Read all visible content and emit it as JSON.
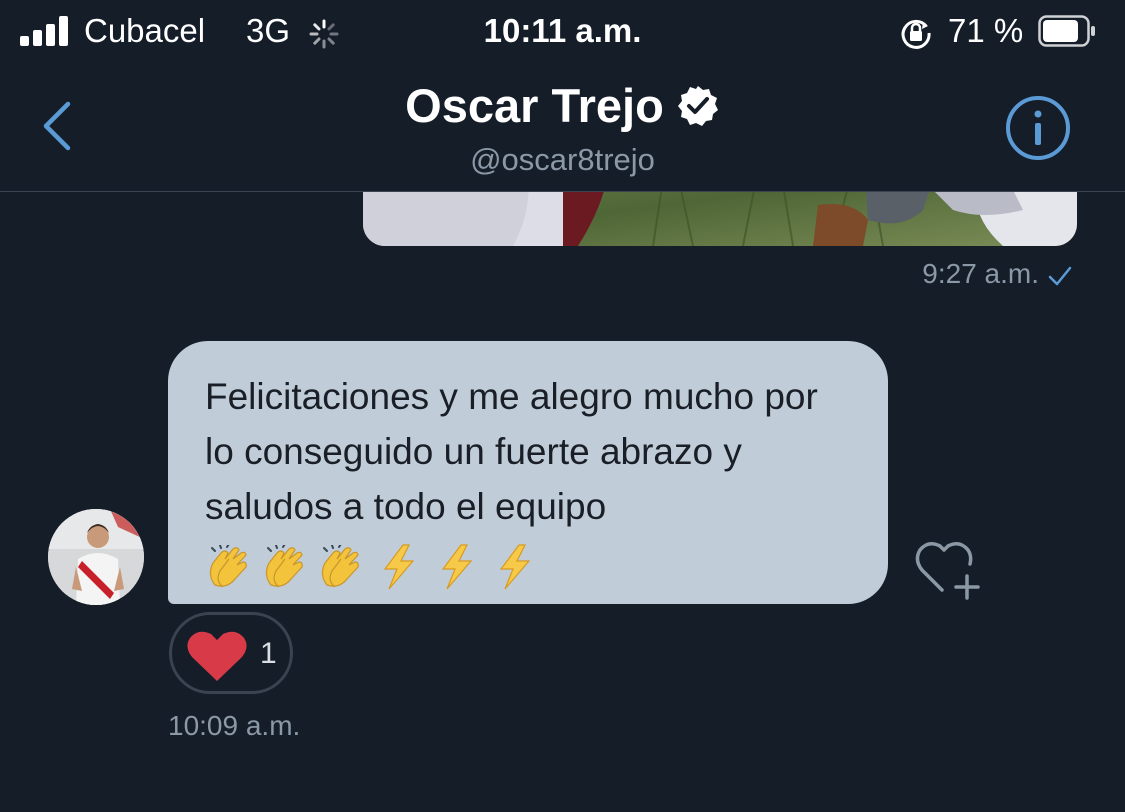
{
  "status_bar": {
    "carrier": "Cubacel",
    "network": "3G",
    "time": "10:11 a.m.",
    "battery_percent": "71 %"
  },
  "header": {
    "name": "Oscar Trejo",
    "handle": "@oscar8trejo"
  },
  "messages": {
    "sent": {
      "time": "9:27 a.m."
    },
    "received": {
      "text": "Felicitaciones y me alegro mucho por lo conseguido un fuerte abrazo y saludos a todo el equipo",
      "emojis": [
        "clapping-hands",
        "clapping-hands",
        "clapping-hands",
        "lightning",
        "lightning",
        "lightning"
      ],
      "time": "10:09 a.m.",
      "reaction_count": "1"
    }
  },
  "colors": {
    "background": "#151d29",
    "bubble": "#c0cdd8",
    "accent": "#5b9bd5",
    "heart": "#e0245e",
    "muted_text": "#8b98a5"
  }
}
